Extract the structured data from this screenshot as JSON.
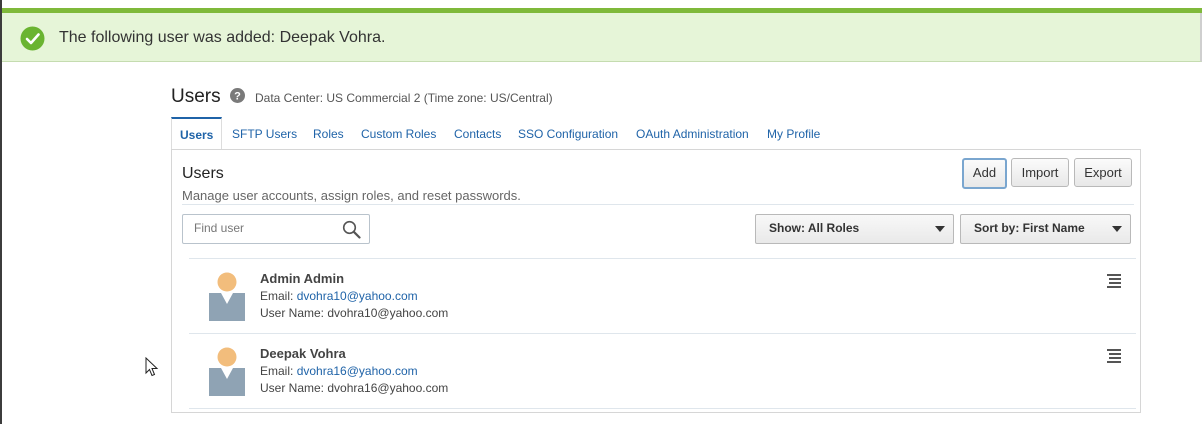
{
  "banner": {
    "message": "The following user was added: Deepak Vohra.",
    "accent_color": "#7fb93a",
    "background_color": "#e6f5d8",
    "icon": "check-circle-icon"
  },
  "header": {
    "title": "Users",
    "help_icon": "help-icon",
    "data_center": "Data Center: US Commercial 2 (Time zone: US/Central)"
  },
  "tabs": [
    {
      "label": "Users",
      "active": true
    },
    {
      "label": "SFTP Users",
      "active": false
    },
    {
      "label": "Roles",
      "active": false
    },
    {
      "label": "Custom Roles",
      "active": false
    },
    {
      "label": "Contacts",
      "active": false
    },
    {
      "label": "SSO Configuration",
      "active": false
    },
    {
      "label": "OAuth Administration",
      "active": false
    },
    {
      "label": "My Profile",
      "active": false
    }
  ],
  "panel": {
    "title": "Users",
    "description": "Manage user accounts, assign roles, and reset passwords.",
    "buttons": {
      "add": "Add",
      "import": "Import",
      "export": "Export"
    }
  },
  "search": {
    "placeholder": "Find user",
    "value": ""
  },
  "filters": {
    "show": "Show: All Roles",
    "sort": "Sort by: First Name"
  },
  "users": [
    {
      "name": "Admin Admin",
      "email_label": "Email:",
      "email": "dvohra10@yahoo.com",
      "username_label": "User Name:",
      "username": "dvohra10@yahoo.com"
    },
    {
      "name": "Deepak Vohra",
      "email_label": "Email:",
      "email": "dvohra16@yahoo.com",
      "username_label": "User Name:",
      "username": "dvohra16@yahoo.com"
    }
  ],
  "colors": {
    "link": "#1f63a8",
    "avatar_head": "#f2bd7c",
    "avatar_body": "#8fa3b4"
  }
}
